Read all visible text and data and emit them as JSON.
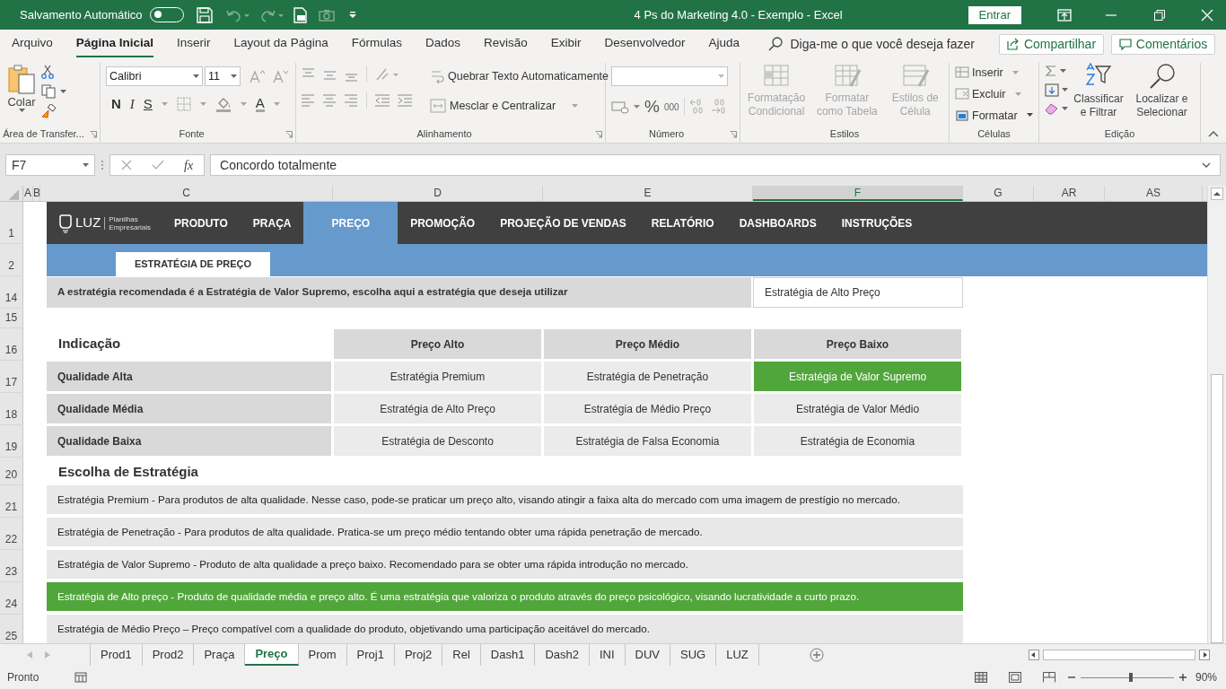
{
  "window": {
    "title": "4 Ps do Marketing 4.0 - Exemplo  -  Excel",
    "autosave": {
      "label": "Salvamento Automático",
      "on": false
    },
    "sign_in": "Entrar"
  },
  "ribbon_tabs": [
    {
      "label": "Arquivo",
      "selected": false
    },
    {
      "label": "Página Inicial",
      "selected": true
    },
    {
      "label": "Inserir",
      "selected": false
    },
    {
      "label": "Layout da Página",
      "selected": false
    },
    {
      "label": "Fórmulas",
      "selected": false
    },
    {
      "label": "Dados",
      "selected": false
    },
    {
      "label": "Revisão",
      "selected": false
    },
    {
      "label": "Exibir",
      "selected": false
    },
    {
      "label": "Desenvolvedor",
      "selected": false
    },
    {
      "label": "Ajuda",
      "selected": false
    }
  ],
  "tell_me": {
    "placeholder": "Diga-me o que você deseja fazer"
  },
  "share_button": "Compartilhar",
  "comments_button": "Comentários",
  "ribbon_groups": [
    {
      "kind": "clipboard",
      "label": "Área de Transfer...",
      "paste": "Colar"
    },
    {
      "kind": "font",
      "label": "Fonte",
      "font_name": "Calibri",
      "font_size": "11",
      "styles": [
        "N",
        "I",
        "S"
      ],
      "font_color": "A"
    },
    {
      "kind": "alignment",
      "label": "Alinhamento",
      "wrap_text": "Quebrar Texto Automaticamente",
      "merge": "Mesclar e Centralizar"
    },
    {
      "kind": "number",
      "label": "Número",
      "percent": "%",
      "thousands": "000"
    },
    {
      "kind": "styles",
      "label": "Estilos",
      "buttons": [
        {
          "label": "Formatação Condicional",
          "disabled": true
        },
        {
          "label": "Formatar como Tabela",
          "disabled": true
        },
        {
          "label": "Estilos de Célula",
          "disabled": true
        }
      ]
    },
    {
      "kind": "cells",
      "label": "Células",
      "buttons": [
        {
          "label": "Inserir",
          "disabled": true
        },
        {
          "label": "Excluir",
          "disabled": true
        },
        {
          "label": "Formatar",
          "disabled": false
        }
      ]
    },
    {
      "kind": "editing",
      "label": "Edição",
      "buttons": [
        {
          "label": "Classificar e Filtrar"
        },
        {
          "label": "Localizar e Selecionar"
        }
      ]
    }
  ],
  "formula_bar": {
    "name_box": "F7",
    "function_label": "fx",
    "formula": "Concordo totalmente"
  },
  "columns": [
    {
      "label": "A",
      "selected": false
    },
    {
      "label": "B",
      "selected": false
    },
    {
      "label": "C",
      "selected": false
    },
    {
      "label": "D",
      "selected": false
    },
    {
      "label": "E",
      "selected": false
    },
    {
      "label": "F",
      "selected": true
    },
    {
      "label": "G",
      "selected": false
    },
    {
      "label": "AR",
      "selected": false
    },
    {
      "label": "AS",
      "selected": false
    }
  ],
  "rows": [
    {
      "number": "1",
      "kind": "nav",
      "logo": "LUZ",
      "logo_tagline": "Planilhas Empresariais",
      "items": [
        {
          "label": "PRODUTO",
          "selected": false
        },
        {
          "label": "PRAÇA",
          "selected": false
        },
        {
          "label": "PREÇO",
          "selected": true
        },
        {
          "label": "PROMOÇÃO",
          "selected": false
        },
        {
          "label": "PROJEÇÃO DE VENDAS",
          "selected": false
        },
        {
          "label": "RELATÓRIO",
          "selected": false
        },
        {
          "label": "DASHBOARDS",
          "selected": false
        },
        {
          "label": "INSTRUÇÕES",
          "selected": false
        }
      ]
    },
    {
      "number": "2",
      "kind": "subtab",
      "text": "ESTRATÉGIA DE PREÇO"
    },
    {
      "number": "14",
      "kind": "prompt",
      "text": "A estratégia recomendada é a Estratégia de Valor Supremo, escolha aqui a estratégia que deseja utilizar",
      "value": "Estratégia de Alto Preço"
    },
    {
      "number": "15",
      "kind": "blank"
    },
    {
      "number": "16",
      "kind": "matrix_header",
      "title": "Indicação",
      "headers": [
        "Preço Alto",
        "Preço Médio",
        "Preço Baixo"
      ]
    },
    {
      "number": "17",
      "kind": "matrix_row",
      "label": "Qualidade Alta",
      "cells": [
        {
          "text": "Estratégia Premium",
          "highlighted": false
        },
        {
          "text": "Estratégia de Penetração",
          "highlighted": false
        },
        {
          "text": "Estratégia de Valor Supremo",
          "highlighted": true
        }
      ]
    },
    {
      "number": "18",
      "kind": "matrix_row",
      "label": "Qualidade Média",
      "cells": [
        {
          "text": "Estratégia de Alto Preço",
          "highlighted": false
        },
        {
          "text": "Estratégia de Médio Preço",
          "highlighted": false
        },
        {
          "text": "Estratégia de Valor Médio",
          "highlighted": false
        }
      ]
    },
    {
      "number": "19",
      "kind": "matrix_row",
      "label": "Qualidade Baixa",
      "cells": [
        {
          "text": "Estratégia de Desconto",
          "highlighted": false
        },
        {
          "text": "Estratégia de Falsa Economia",
          "highlighted": false
        },
        {
          "text": "Estratégia de Economia",
          "highlighted": false
        }
      ]
    },
    {
      "number": "20",
      "kind": "section_title",
      "text": "Escolha de Estratégia"
    },
    {
      "number": "21",
      "kind": "description",
      "text": "Estratégia Premium - Para produtos de alta qualidade. Nesse caso, pode-se praticar um preço alto, visando atingir a faixa alta do mercado com uma imagem de prestígio no mercado.",
      "highlighted": false
    },
    {
      "number": "22",
      "kind": "description",
      "text": "Estratégia de Penetração - Para produtos de alta qualidade. Pratica-se um preço médio tentando obter uma rápida penetração de mercado.",
      "highlighted": false
    },
    {
      "number": "23",
      "kind": "description",
      "text": "Estratégia de Valor Supremo - Produto de alta qualidade a preço baixo. Recomendado para se obter uma rápida introdução no mercado.",
      "highlighted": false
    },
    {
      "number": "24",
      "kind": "description",
      "text": "Estratégia de Alto preço - Produto de qualidade média e preço alto. É uma estratégia que valoriza o produto através do preço psicológico, visando lucratividade a curto prazo.",
      "highlighted": true
    },
    {
      "number": "25",
      "kind": "description",
      "text": "Estratégia de Médio Preço – Preço compatível com a qualidade do produto, objetivando uma participação aceitável do mercado.",
      "highlighted": false
    }
  ],
  "sheet_tabs": [
    {
      "label": "Prod1",
      "selected": false
    },
    {
      "label": "Prod2",
      "selected": false
    },
    {
      "label": "Praça",
      "selected": false
    },
    {
      "label": "Preço",
      "selected": true
    },
    {
      "label": "Prom",
      "selected": false
    },
    {
      "label": "Proj1",
      "selected": false
    },
    {
      "label": "Proj2",
      "selected": false
    },
    {
      "label": "Rel",
      "selected": false
    },
    {
      "label": "Dash1",
      "selected": false
    },
    {
      "label": "Dash2",
      "selected": false
    },
    {
      "label": "INI",
      "selected": false
    },
    {
      "label": "DUV",
      "selected": false
    },
    {
      "label": "SUG",
      "selected": false
    },
    {
      "label": "LUZ",
      "selected": false
    }
  ],
  "status_bar": {
    "status": "Pronto",
    "zoom": {
      "level": 0.54,
      "reading": "90%"
    }
  }
}
